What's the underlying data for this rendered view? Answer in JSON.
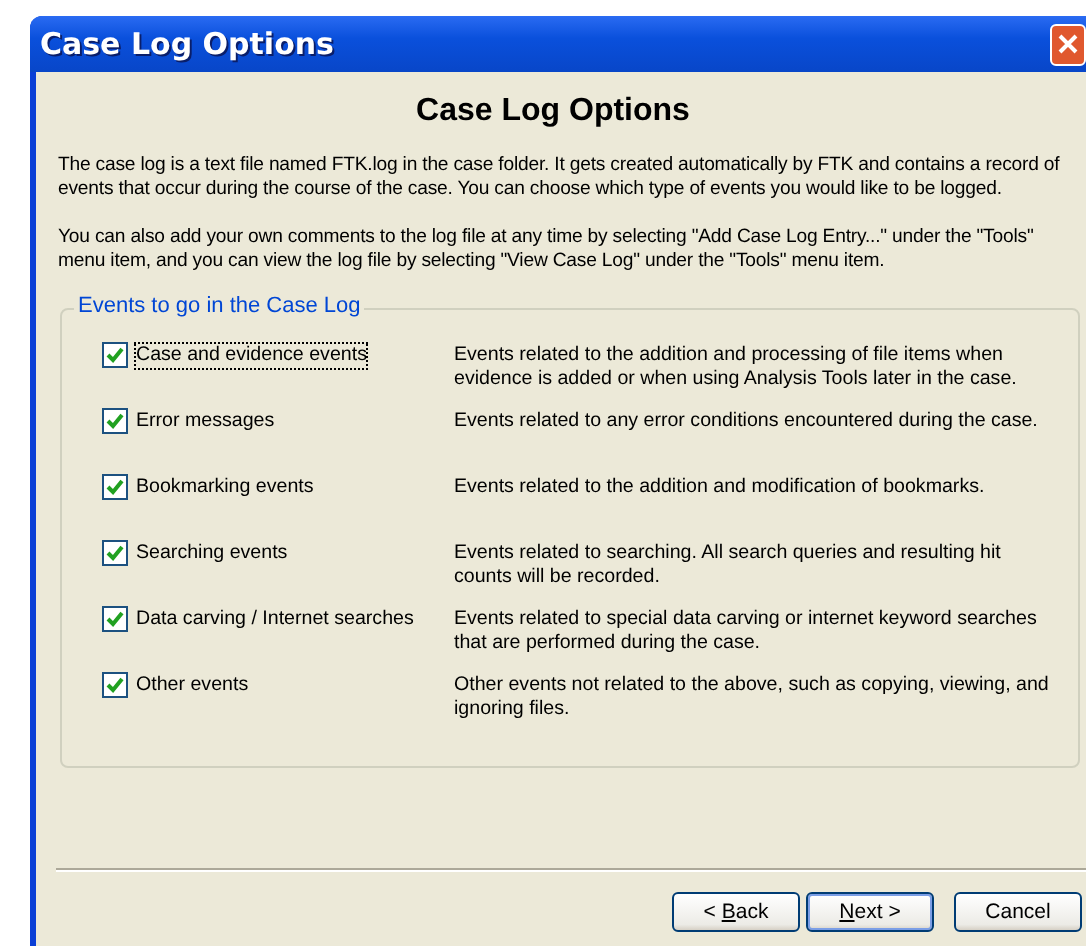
{
  "window": {
    "title": "Case Log Options"
  },
  "heading": "Case Log Options",
  "paragraphs": [
    "The case log is a text file named FTK.log in the case folder. It gets created automatically by FTK and contains a record of events that occur during the course of the case. You can choose which type of events you would like to be logged.",
    "You can also add your own comments to the log file at any time by selecting \"Add Case Log Entry...\" under the \"Tools\" menu item, and you can view the log file by selecting \"View Case Log\" under the \"Tools\" menu item."
  ],
  "group": {
    "title": "Events to go in the Case Log",
    "options": [
      {
        "label": "Case and evidence events",
        "checked": true,
        "focused": true,
        "description": "Events related to the addition and processing of file items when evidence is added or when using Analysis Tools later in the case."
      },
      {
        "label": "Error messages",
        "checked": true,
        "focused": false,
        "description": "Events related to any error conditions encountered during the case."
      },
      {
        "label": "Bookmarking events",
        "checked": true,
        "focused": false,
        "description": "Events related to the addition and modification of bookmarks."
      },
      {
        "label": "Searching events",
        "checked": true,
        "focused": false,
        "description": "Events related to searching. All search queries and resulting hit counts will be recorded."
      },
      {
        "label": "Data carving / Internet searches",
        "checked": true,
        "focused": false,
        "description": "Events related to special data carving or internet keyword searches that are performed during the case."
      },
      {
        "label": "Other events",
        "checked": true,
        "focused": false,
        "description": "Other events not related to the above, such as copying, viewing, and ignoring files."
      }
    ]
  },
  "buttons": [
    {
      "before_key": "< ",
      "access_key": "B",
      "after_key": "ack",
      "default": false
    },
    {
      "access_key": "N",
      "after_key": "ext >",
      "default": true
    },
    {
      "label": "Cancel",
      "default": false
    }
  ]
}
